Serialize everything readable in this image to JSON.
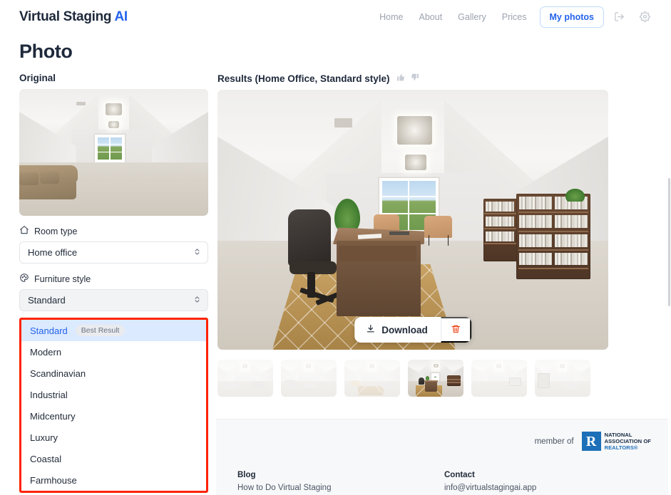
{
  "header": {
    "brand_main": "Virtual Staging ",
    "brand_accent": "AI",
    "nav": [
      {
        "label": "Home",
        "name": "nav-home"
      },
      {
        "label": "About",
        "name": "nav-about"
      },
      {
        "label": "Gallery",
        "name": "nav-gallery"
      },
      {
        "label": "Prices",
        "name": "nav-prices"
      }
    ],
    "my_photos_label": "My photos",
    "logout_icon": "logout-icon",
    "settings_icon": "gear-icon"
  },
  "page": {
    "title": "Photo"
  },
  "original": {
    "label": "Original"
  },
  "results": {
    "label": "Results (Home Office, Standard style)",
    "thumbs_up_icon": "thumbs-up-icon",
    "thumbs_down_icon": "thumbs-down-icon",
    "download_label": "Download",
    "download_icon": "download-icon",
    "delete_icon": "trash-icon",
    "thumbnails": [
      {
        "index": 1,
        "selected": false
      },
      {
        "index": 2,
        "selected": false
      },
      {
        "index": 3,
        "selected": false
      },
      {
        "index": 4,
        "selected": true
      },
      {
        "index": 5,
        "selected": false
      },
      {
        "index": 6,
        "selected": false
      }
    ]
  },
  "controls": {
    "room_type_label": "Room type",
    "room_type_icon": "home-icon",
    "room_type_value": "Home office",
    "furniture_style_label": "Furniture style",
    "furniture_style_icon": "palette-icon",
    "furniture_style_value": "Standard",
    "selector_icon": "chevron-updown-icon"
  },
  "dropdown": {
    "highlight_color": "#ff2200",
    "selected_bg": "#dbeafe",
    "selected_fg": "#2563eb",
    "items": [
      {
        "label": "Standard",
        "badge": "Best Result",
        "selected": true
      },
      {
        "label": "Modern",
        "badge": "",
        "selected": false
      },
      {
        "label": "Scandinavian",
        "badge": "",
        "selected": false
      },
      {
        "label": "Industrial",
        "badge": "",
        "selected": false
      },
      {
        "label": "Midcentury",
        "badge": "",
        "selected": false
      },
      {
        "label": "Luxury",
        "badge": "",
        "selected": false
      },
      {
        "label": "Coastal",
        "badge": "",
        "selected": false
      },
      {
        "label": "Farmhouse",
        "badge": "",
        "selected": false
      }
    ]
  },
  "footer": {
    "member_of": "member of",
    "nar": {
      "line1": "NATIONAL",
      "line2": "ASSOCIATION OF",
      "line3": "REALTORS®",
      "mark": "R"
    },
    "columns": [
      {
        "heading": "Blog",
        "link": "How to Do Virtual Staging"
      },
      {
        "heading": "Contact",
        "link": "info@virtualstagingai.app"
      }
    ]
  },
  "theme": {
    "accent_blue": "#2563eb",
    "text_dark": "#1e293b",
    "muted": "#9ca3af",
    "footer_bg": "#f7f8fa"
  }
}
